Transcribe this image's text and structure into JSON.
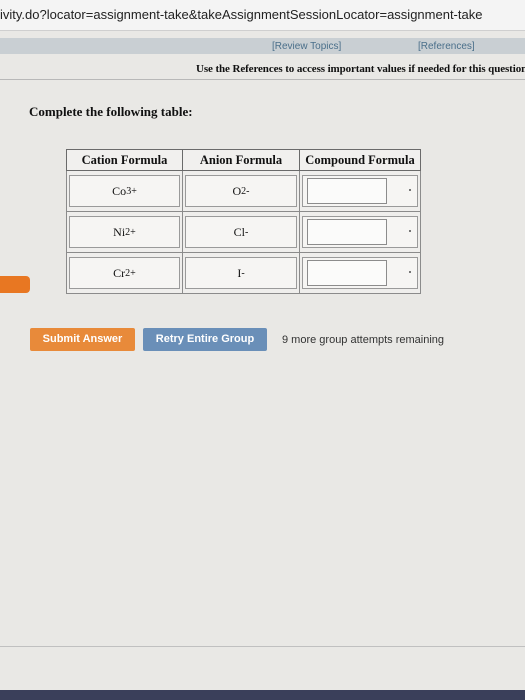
{
  "browser": {
    "url": "ivity.do?locator=assignment-take&takeAssignmentSessionLocator=assignment-take"
  },
  "topnav": {
    "review_topics": "[Review Topics]",
    "references": "[References]"
  },
  "notice": "Use the References to access important values if needed for this question.",
  "instruction": "Complete the following table:",
  "table": {
    "headers": [
      "Cation Formula",
      "Anion Formula",
      "Compound Formula"
    ],
    "rows": [
      {
        "cation": "Co",
        "cation_sup": "3+",
        "anion": "O",
        "anion_sup": "2-"
      },
      {
        "cation": "Ni",
        "cation_sup": "2+",
        "anion": "Cl",
        "anion_sup": "-"
      },
      {
        "cation": "Cr",
        "cation_sup": "2+",
        "anion": "I",
        "anion_sup": "-"
      }
    ]
  },
  "buttons": {
    "submit": "Submit Answer",
    "retry": "Retry Entire Group"
  },
  "attempts": "9 more group attempts remaining",
  "colors": {
    "submit": "#e88a3a",
    "retry": "#6a8fb8",
    "orange_tab": "#e87722"
  }
}
